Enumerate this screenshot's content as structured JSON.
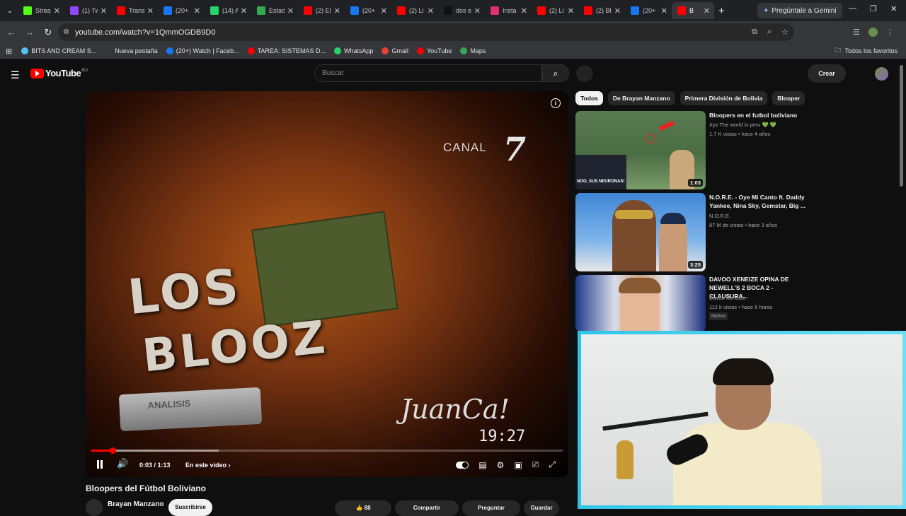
{
  "browser": {
    "tabs": [
      {
        "title": "Strea",
        "color": "#53fc18"
      },
      {
        "title": "(1) Tw",
        "color": "#9146ff"
      },
      {
        "title": "Trans",
        "color": "#ff0000"
      },
      {
        "title": "(20+",
        "color": "#1877f2"
      },
      {
        "title": "(14) A",
        "color": "#25d366"
      },
      {
        "title": "Estad",
        "color": "#34a853"
      },
      {
        "title": "(2) El",
        "color": "#ff0000"
      },
      {
        "title": "(20+",
        "color": "#1877f2"
      },
      {
        "title": "(2) Li",
        "color": "#ff0000"
      },
      {
        "title": "dos e",
        "color": "#111111"
      },
      {
        "title": "Insta",
        "color": "#e1306c"
      },
      {
        "title": "(2) Li",
        "color": "#ff0000"
      },
      {
        "title": "(2) Bl",
        "color": "#ff0000"
      },
      {
        "title": "(20+",
        "color": "#1877f2"
      },
      {
        "title": "B",
        "color": "#ff0000"
      }
    ],
    "gemini_label": "Pregúntale a Gemini",
    "url": "youtube.com/watch?v=1QmmOGDB9D0",
    "bookmarks": [
      {
        "label": "BITS AND CREAM S...",
        "color": "#4fc3f7"
      },
      {
        "label": "Nueva pestaña",
        "color": ""
      },
      {
        "label": "(20+) Watch | Faceb...",
        "color": "#1877f2"
      },
      {
        "label": "TAREA: SISTEMAS D...",
        "color": "#ff0000"
      },
      {
        "label": "WhatsApp",
        "color": "#25d366"
      },
      {
        "label": "Gmail",
        "color": "#ea4335"
      },
      {
        "label": "YouTube",
        "color": "#ff0000"
      },
      {
        "label": "Maps",
        "color": "#34a853"
      }
    ],
    "all_bookmarks_label": "Todos los favoritos"
  },
  "youtube": {
    "logo_text": "YouTube",
    "country_code": "BO",
    "search_placeholder": "Buscar",
    "create_label": "Crear"
  },
  "player": {
    "overlay": {
      "canal": "CANAL",
      "canal_number": "7",
      "los": "LOS",
      "blooz": "BLOOZ",
      "sign": "ANALISIS",
      "signature": "JuanCa!",
      "clock": "19:27"
    },
    "progress_fraction": 0.045,
    "buffered_fraction": 0.27,
    "time_display": "0:03 / 1:13",
    "chapter_label": "En este video"
  },
  "video": {
    "title": "Bloopers del Fútbol Boliviano",
    "channel": "Brayan Manzano",
    "subscribe_label": "Suscribirse",
    "likes": "88",
    "share_label": "Compartir",
    "ask_label": "Preguntar",
    "save_label": "Guardar"
  },
  "chips": [
    "Todos",
    "De Brayan Manzano",
    "Primera División de Bolivia",
    "Blooper"
  ],
  "recommendations": [
    {
      "title": "Bloopers en el futbol boliviano",
      "channel": "Xyz The world in peru 💚 💚",
      "meta": "1,7 K vistas • hace 4 años",
      "duration": "1:03",
      "thumb_caption": "NOO, SUS NEURONAS!"
    },
    {
      "title": "N.O.R.E. - Oye Mi Canto ft. Daddy Yankee, Nina Sky, Gemstar, Big ...",
      "channel": "N.O.R.E.",
      "meta": "87 M de vistas • hace 3 años",
      "duration": "3:25"
    },
    {
      "title": "DAVOO XENEIZE OPINA DE NEWELL'S 2 BOCA 2 - CLAUSURA...",
      "channel": "Davoo Xeneize",
      "meta": "112 k vistas • hace 6 horas",
      "badge": "Nuevo"
    }
  ]
}
